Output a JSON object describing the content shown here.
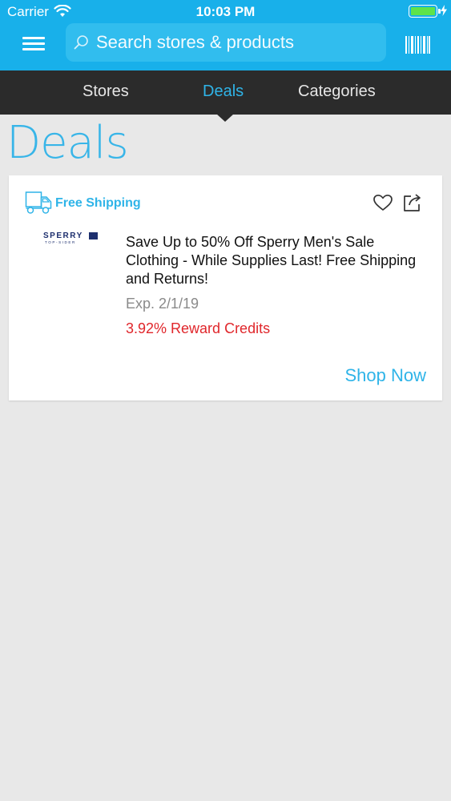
{
  "status_bar": {
    "carrier": "Carrier",
    "time": "10:03 PM"
  },
  "header": {
    "search_placeholder": "Search stores & products",
    "icons": [
      "menu-icon",
      "search-icon",
      "barcode-icon"
    ]
  },
  "tabs": [
    {
      "label": "Stores",
      "active": false
    },
    {
      "label": "Deals",
      "active": true
    },
    {
      "label": "Categories",
      "active": false
    }
  ],
  "page_title": "Deals",
  "deal": {
    "badge": "Free Shipping",
    "store_logo": {
      "name": "SPERRY",
      "tagline": "TOP-SIDER"
    },
    "description": "Save Up to 50% Off Sperry Men's Sale Clothing - While Supplies Last! Free Shipping and Returns!",
    "expiry": "Exp. 2/1/19",
    "reward": "3.92% Reward Credits",
    "cta": "Shop Now"
  },
  "colors": {
    "brand_blue": "#18b0ea",
    "accent_blue": "#2fb4e8",
    "tab_bar": "#2b2b2b",
    "reward_red": "#e0262b",
    "background": "#e8e8e8"
  }
}
